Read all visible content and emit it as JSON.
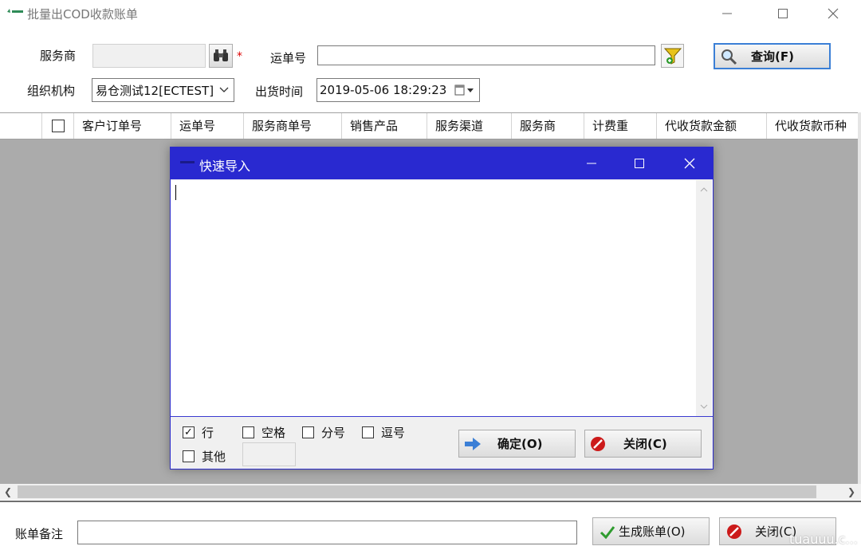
{
  "window": {
    "title": "批量出COD收款账单",
    "controls": [
      "minimize-icon",
      "maximize-icon",
      "close-icon"
    ]
  },
  "form": {
    "service_provider_label": "服务商",
    "service_provider_value": "",
    "tracking_no_label": "运单号",
    "tracking_no_value": "",
    "query_button": "查询(F)",
    "org_label": "组织机构",
    "org_value": "易仓测试12[ECTEST]",
    "ship_time_label": "出货时间",
    "ship_time_value": "2019-05-06 18:29:23",
    "required_mark": "*"
  },
  "grid": {
    "columns": [
      "客户订单号",
      "运单号",
      "服务商单号",
      "销售产品",
      "服务渠道",
      "服务商",
      "计费重",
      "代收货款金额",
      "代收货款币种"
    ],
    "rows": []
  },
  "dialog": {
    "title": "快速导入",
    "text_value": "",
    "options": [
      {
        "label": "行",
        "checked": true
      },
      {
        "label": "空格",
        "checked": false
      },
      {
        "label": "分号",
        "checked": false
      },
      {
        "label": "逗号",
        "checked": false
      },
      {
        "label": "其他",
        "checked": false
      }
    ],
    "other_value": "",
    "ok_button": "确定(O)",
    "close_button": "关闭(C)"
  },
  "footer": {
    "remark_label": "账单备注",
    "remark_value": "",
    "generate_button": "生成账单(O)",
    "close_button": "关闭(C)"
  },
  "watermark": "tuauuu.c..."
}
